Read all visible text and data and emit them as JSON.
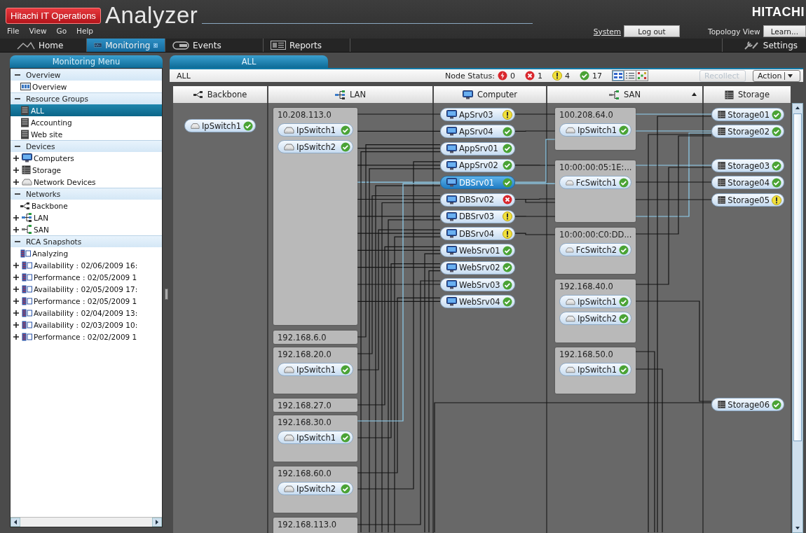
{
  "app": {
    "brand": "Hitachi IT Operations",
    "product": "Analyzer",
    "vendor": "HITACHI"
  },
  "menu": [
    "File",
    "View",
    "Go",
    "Help"
  ],
  "session": {
    "system_link": "System",
    "logout": "Log out",
    "topology_view": "Topology View",
    "learn": "Learn..."
  },
  "nav": [
    {
      "label": "Home",
      "kind": "home",
      "selected": false
    },
    {
      "label": "Monitoring",
      "kind": "monitoring",
      "selected": true
    },
    {
      "label": "Events",
      "kind": "events",
      "selected": false
    },
    {
      "label": "Reports",
      "kind": "reports",
      "selected": false
    }
  ],
  "settings": "Settings",
  "sidebar": {
    "title": "Monitoring Menu",
    "sections": [
      {
        "label": "Overview",
        "expanded": true,
        "children": [
          {
            "label": "Overview",
            "kind": "overview",
            "selected": false
          }
        ]
      },
      {
        "label": "Resource Groups",
        "expanded": true,
        "children": [
          {
            "label": "ALL",
            "kind": "group",
            "selected": true
          },
          {
            "label": "Accounting",
            "kind": "group",
            "selected": false
          },
          {
            "label": "Web site",
            "kind": "group",
            "selected": false
          }
        ]
      },
      {
        "label": "Devices",
        "expanded": true,
        "children": [
          {
            "label": "Computers",
            "kind": "computer",
            "selected": false,
            "expanded": false
          },
          {
            "label": "Storage",
            "kind": "storage",
            "selected": false,
            "expanded": false
          },
          {
            "label": "Network Devices",
            "kind": "network",
            "selected": false,
            "expanded": false
          }
        ]
      },
      {
        "label": "Networks",
        "expanded": true,
        "children": [
          {
            "label": "Backbone",
            "kind": "backbone",
            "selected": false
          },
          {
            "label": "LAN",
            "kind": "lan",
            "selected": false,
            "expanded": false
          },
          {
            "label": "SAN",
            "kind": "san",
            "selected": false,
            "expanded": false
          }
        ]
      },
      {
        "label": "RCA Snapshots",
        "expanded": true,
        "children": [
          {
            "label": "Analyzing",
            "kind": "snapshot",
            "selected": false
          },
          {
            "label": "Availability : 02/06/2009 16:",
            "kind": "snapshot",
            "selected": false,
            "expanded": false
          },
          {
            "label": "Performance : 02/05/2009 1",
            "kind": "snapshot",
            "selected": false,
            "expanded": false
          },
          {
            "label": "Availability : 02/05/2009 17:",
            "kind": "snapshot",
            "selected": false,
            "expanded": false
          },
          {
            "label": "Performance : 02/05/2009 1",
            "kind": "snapshot",
            "selected": false,
            "expanded": false
          },
          {
            "label": "Availability : 02/04/2009 13:",
            "kind": "snapshot",
            "selected": false,
            "expanded": false
          },
          {
            "label": "Availability : 02/03/2009 10:",
            "kind": "snapshot",
            "selected": false,
            "expanded": false
          },
          {
            "label": "Performance : 02/02/2009 1",
            "kind": "snapshot",
            "selected": false,
            "expanded": false
          }
        ]
      }
    ]
  },
  "tab": {
    "label": "ALL",
    "selected": true
  },
  "toolbar": {
    "scope": "ALL",
    "node_status_label": "Node Status:",
    "counts": [
      {
        "kind": "critical",
        "count": "0"
      },
      {
        "kind": "error",
        "count": "1"
      },
      {
        "kind": "warning",
        "count": "4"
      },
      {
        "kind": "ok",
        "count": "17"
      }
    ],
    "views": [
      {
        "kind": "map",
        "selected": true
      },
      {
        "kind": "list",
        "selected": false
      },
      {
        "kind": "matrix",
        "selected": false
      }
    ],
    "recollect": {
      "label": "Recollect",
      "disabled": true
    },
    "action": {
      "label": "Action"
    }
  },
  "columns": [
    {
      "label": "Backbone",
      "kind": "backbone",
      "sorted": false
    },
    {
      "label": "LAN",
      "kind": "lan",
      "sorted": false
    },
    {
      "label": "Computer",
      "kind": "computer",
      "sorted": false
    },
    {
      "label": "SAN",
      "kind": "san",
      "sorted": true
    },
    {
      "label": "Storage",
      "kind": "storage",
      "sorted": false
    }
  ],
  "backbone": [
    {
      "name": "IpSwitch1",
      "kind": "ok"
    }
  ],
  "lan": [
    {
      "subnet": "10.208.113.0",
      "members": [
        {
          "name": "IpSwitch1",
          "kind": "ok"
        },
        {
          "name": "IpSwitch2",
          "kind": "ok"
        }
      ]
    },
    {
      "subnet": "192.168.6.0"
    },
    {
      "subnet": "192.168.20.0",
      "members": [
        {
          "name": "IpSwitch1",
          "kind": "ok"
        }
      ]
    },
    {
      "subnet": "192.168.27.0"
    },
    {
      "subnet": "192.168.30.0",
      "members": [
        {
          "name": "IpSwitch1",
          "kind": "ok"
        }
      ]
    },
    {
      "subnet": "192.168.60.0",
      "members": [
        {
          "name": "IpSwitch2",
          "kind": "ok"
        }
      ]
    },
    {
      "subnet": "192.168.113.0"
    }
  ],
  "computers": [
    {
      "name": "ApSrv03",
      "kind": "warning",
      "selected": false
    },
    {
      "name": "ApSrv04",
      "kind": "ok",
      "selected": false
    },
    {
      "name": "AppSrv01",
      "kind": "ok",
      "selected": false
    },
    {
      "name": "AppSrv02",
      "kind": "ok",
      "selected": false
    },
    {
      "name": "DBSrv01",
      "kind": "ok",
      "selected": true
    },
    {
      "name": "DBSrv02",
      "kind": "error",
      "selected": false
    },
    {
      "name": "DBSrv03",
      "kind": "warning",
      "selected": false
    },
    {
      "name": "DBSrv04",
      "kind": "warning",
      "selected": false
    },
    {
      "name": "WebSrv01",
      "kind": "ok",
      "selected": false
    },
    {
      "name": "WebSrv02",
      "kind": "ok",
      "selected": false
    },
    {
      "name": "WebSrv03",
      "kind": "ok",
      "selected": false
    },
    {
      "name": "WebSrv04",
      "kind": "ok",
      "selected": false
    }
  ],
  "san": [
    {
      "subnet": "100.208.64.0",
      "members": [
        {
          "name": "IpSwitch1",
          "kind": "ok"
        }
      ]
    },
    {
      "subnet": "10:00:00:05:1E:...",
      "members": [
        {
          "name": "FcSwitch1",
          "kind": "ok"
        }
      ]
    },
    {
      "subnet": "10:00:00:C0:DD...",
      "members": [
        {
          "name": "FcSwitch2",
          "kind": "ok"
        }
      ]
    },
    {
      "subnet": "192.168.40.0",
      "members": [
        {
          "name": "IpSwitch1",
          "kind": "ok"
        },
        {
          "name": "IpSwitch2",
          "kind": "ok"
        }
      ]
    },
    {
      "subnet": "192.168.50.0",
      "members": [
        {
          "name": "IpSwitch1",
          "kind": "ok"
        }
      ]
    }
  ],
  "storage": [
    {
      "name": "Storage01",
      "kind": "ok"
    },
    {
      "name": "Storage02",
      "kind": "ok"
    },
    {
      "name": "Storage03",
      "kind": "ok"
    },
    {
      "name": "Storage04",
      "kind": "ok"
    },
    {
      "name": "Storage05",
      "kind": "warning"
    },
    {
      "name": "Storage06",
      "kind": "ok"
    }
  ]
}
